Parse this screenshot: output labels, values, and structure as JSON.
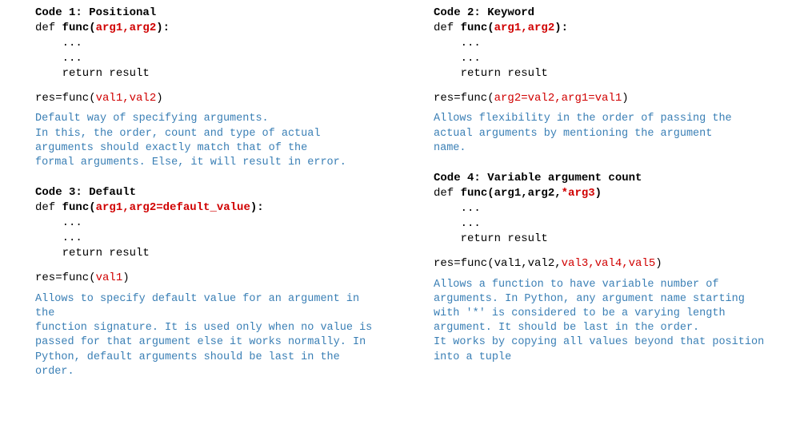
{
  "code1": {
    "title": "Code 1: Positional",
    "def_kw": "def ",
    "fn": "func",
    "open": "(",
    "args": "arg1,arg2",
    "close": "):",
    "body1": "    ...",
    "body2": "    ...",
    "body3": "    return result",
    "call_prefix": "res=func(",
    "call_args": "val1,val2",
    "call_suffix": ")",
    "desc": "Default way of specifying arguments.\nIn this, the order, count and type of actual\narguments should exactly match that of the\nformal arguments. Else, it will result in error."
  },
  "code2": {
    "title": "Code 2: Keyword",
    "def_kw": "def ",
    "fn": "func",
    "open": "(",
    "args": "arg1,arg2",
    "close": "):",
    "body1": "    ...",
    "body2": "    ...",
    "body3": "    return result",
    "call_prefix": "res=func(",
    "call_args": "arg2=val2,arg1=val1",
    "call_suffix": ")",
    "desc": "Allows flexibility in the order of passing the\nactual arguments by mentioning the argument\nname."
  },
  "code3": {
    "title": "Code 3: Default",
    "def_kw": "def ",
    "fn": "func",
    "open": "(",
    "args": "arg1,arg2=default_value",
    "close": "):",
    "body1": "    ...",
    "body2": "    ...",
    "body3": "    return result",
    "call_prefix": "res=func(",
    "call_args": "val1",
    "call_suffix": ")",
    "desc": "Allows to specify default value for an argument in the\nfunction signature. It is used only when no value is\npassed for that argument else it works normally. In\nPython, default arguments should be last in the order."
  },
  "code4": {
    "title": "Code 4: Variable argument count",
    "def_kw": "def ",
    "fn": "func",
    "open": "(",
    "args_black": "arg1,arg2,",
    "args_red": "*arg3",
    "close": ")",
    "body1": "    ...",
    "body2": "    ...",
    "body3": "    return result",
    "call_prefix": "res=func(val1,val2,",
    "call_args": "val3,val4,val5",
    "call_suffix": ")",
    "desc": "Allows a function to have variable number of\narguments. In Python, any argument name starting\nwith '*' is considered to be a varying length\nargument. It should be last in the order.\nIt works by copying all values beyond that position\ninto a tuple"
  }
}
